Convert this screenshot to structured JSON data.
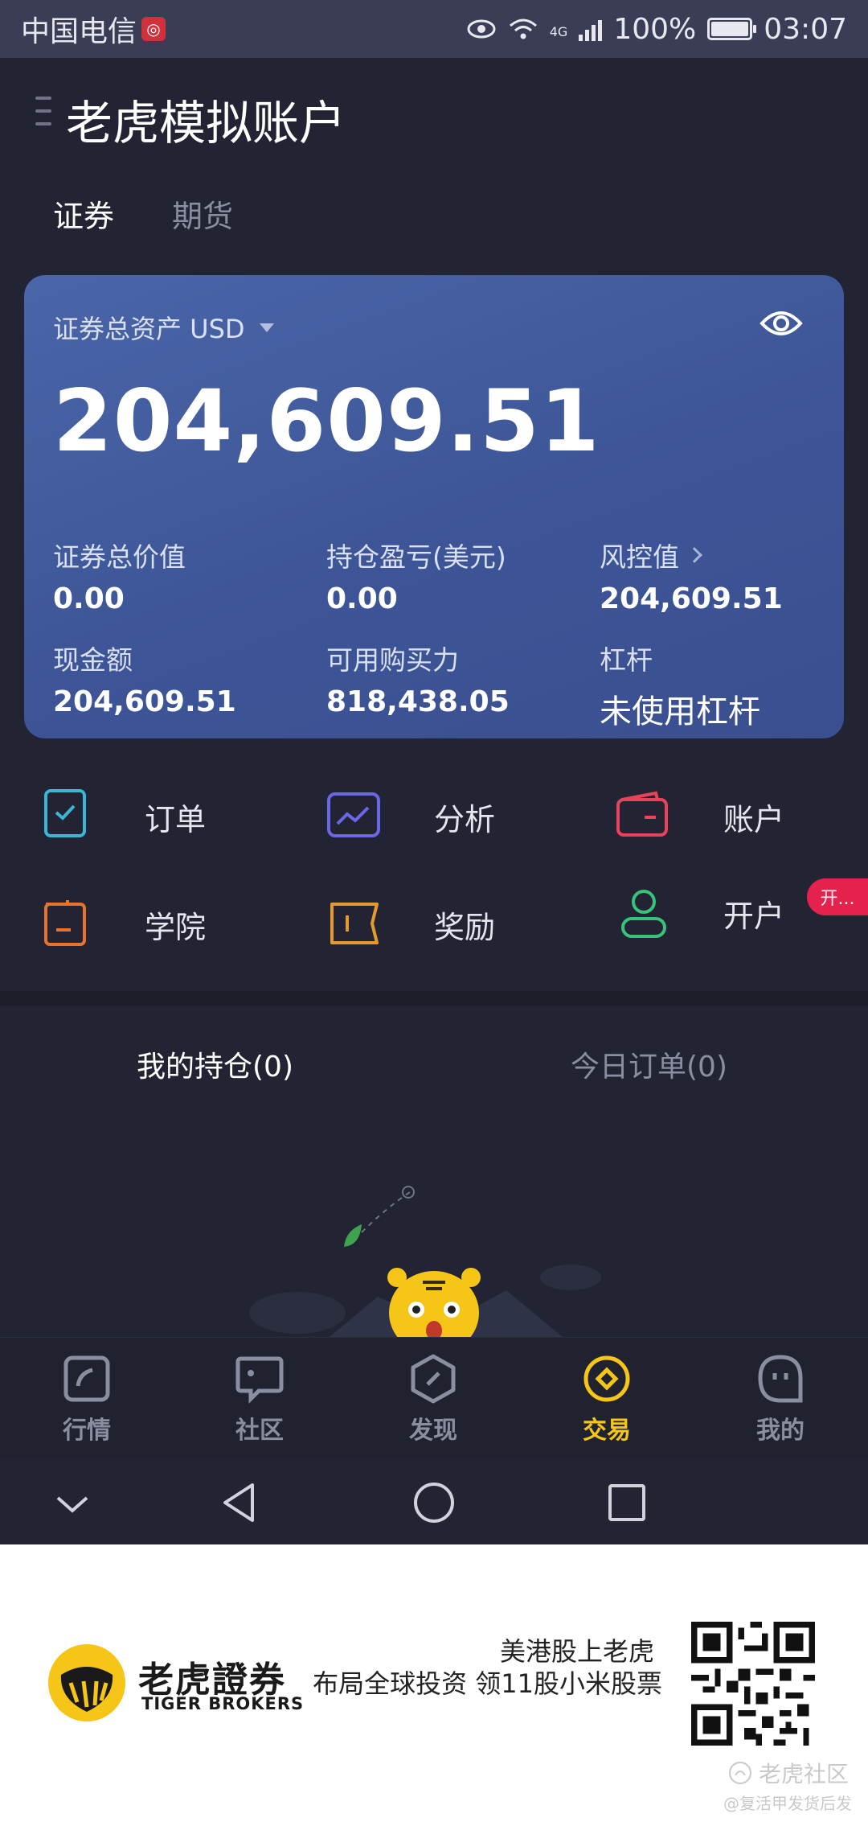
{
  "status_bar": {
    "carrier": "中国电信",
    "network": "4G",
    "battery": "100%",
    "battery_level": 1.0,
    "time": "03:07"
  },
  "header": {
    "title": "老虎模拟账户"
  },
  "tabs": [
    {
      "label": "证券",
      "active": true
    },
    {
      "label": "期货",
      "active": false
    }
  ],
  "summary_card": {
    "asset_label": "证券总资产 USD",
    "asset_value": "204,609.51",
    "stats": [
      {
        "label": "证券总价值",
        "value": "0.00"
      },
      {
        "label": "持仓盈亏(美元)",
        "value": "0.00"
      },
      {
        "label": "风控值",
        "value": "204,609.51"
      },
      {
        "label": "现金额",
        "value": "204,609.51"
      },
      {
        "label": "可用购买力",
        "value": "818,438.05"
      },
      {
        "label": "杠杆",
        "value": "未使用杠杆"
      }
    ]
  },
  "shortcuts": [
    {
      "label": "订单",
      "icon": "order-check-icon",
      "color": "#3ab6d6"
    },
    {
      "label": "分析",
      "icon": "analysis-chart-icon",
      "color": "#6a67e8"
    },
    {
      "label": "账户",
      "icon": "wallet-icon",
      "color": "#e8435a"
    },
    {
      "label": "学院",
      "icon": "folder-icon",
      "color": "#e8732e"
    },
    {
      "label": "奖励",
      "icon": "ticket-icon",
      "color": "#e69a2e"
    },
    {
      "label": "开户",
      "icon": "user-icon",
      "color": "#3ac27a"
    }
  ],
  "badge": {
    "text": "开..."
  },
  "holding_tabs": [
    {
      "label": "我的持仓(0)",
      "active": true
    },
    {
      "label": "今日订单(0)",
      "active": false
    }
  ],
  "bottom_nav": [
    {
      "label": "行情",
      "icon": "market-icon",
      "active": false
    },
    {
      "label": "社区",
      "icon": "community-icon",
      "active": false
    },
    {
      "label": "发现",
      "icon": "discover-icon",
      "active": false
    },
    {
      "label": "交易",
      "icon": "trade-icon",
      "active": true
    },
    {
      "label": "我的",
      "icon": "profile-icon",
      "active": false
    }
  ],
  "promo": {
    "brand_cn": "老虎證券",
    "brand_en": "TIGER BROKERS",
    "line1": "美港股上老虎",
    "line2": "布局全球投资 领11股小米股票",
    "watermark": "老虎社区",
    "watermark_sub": "@复活甲发货后发"
  },
  "colors": {
    "background": "#222433",
    "card": "#3d5597",
    "accent_active": "#f5c518",
    "badge": "#e5214d"
  }
}
